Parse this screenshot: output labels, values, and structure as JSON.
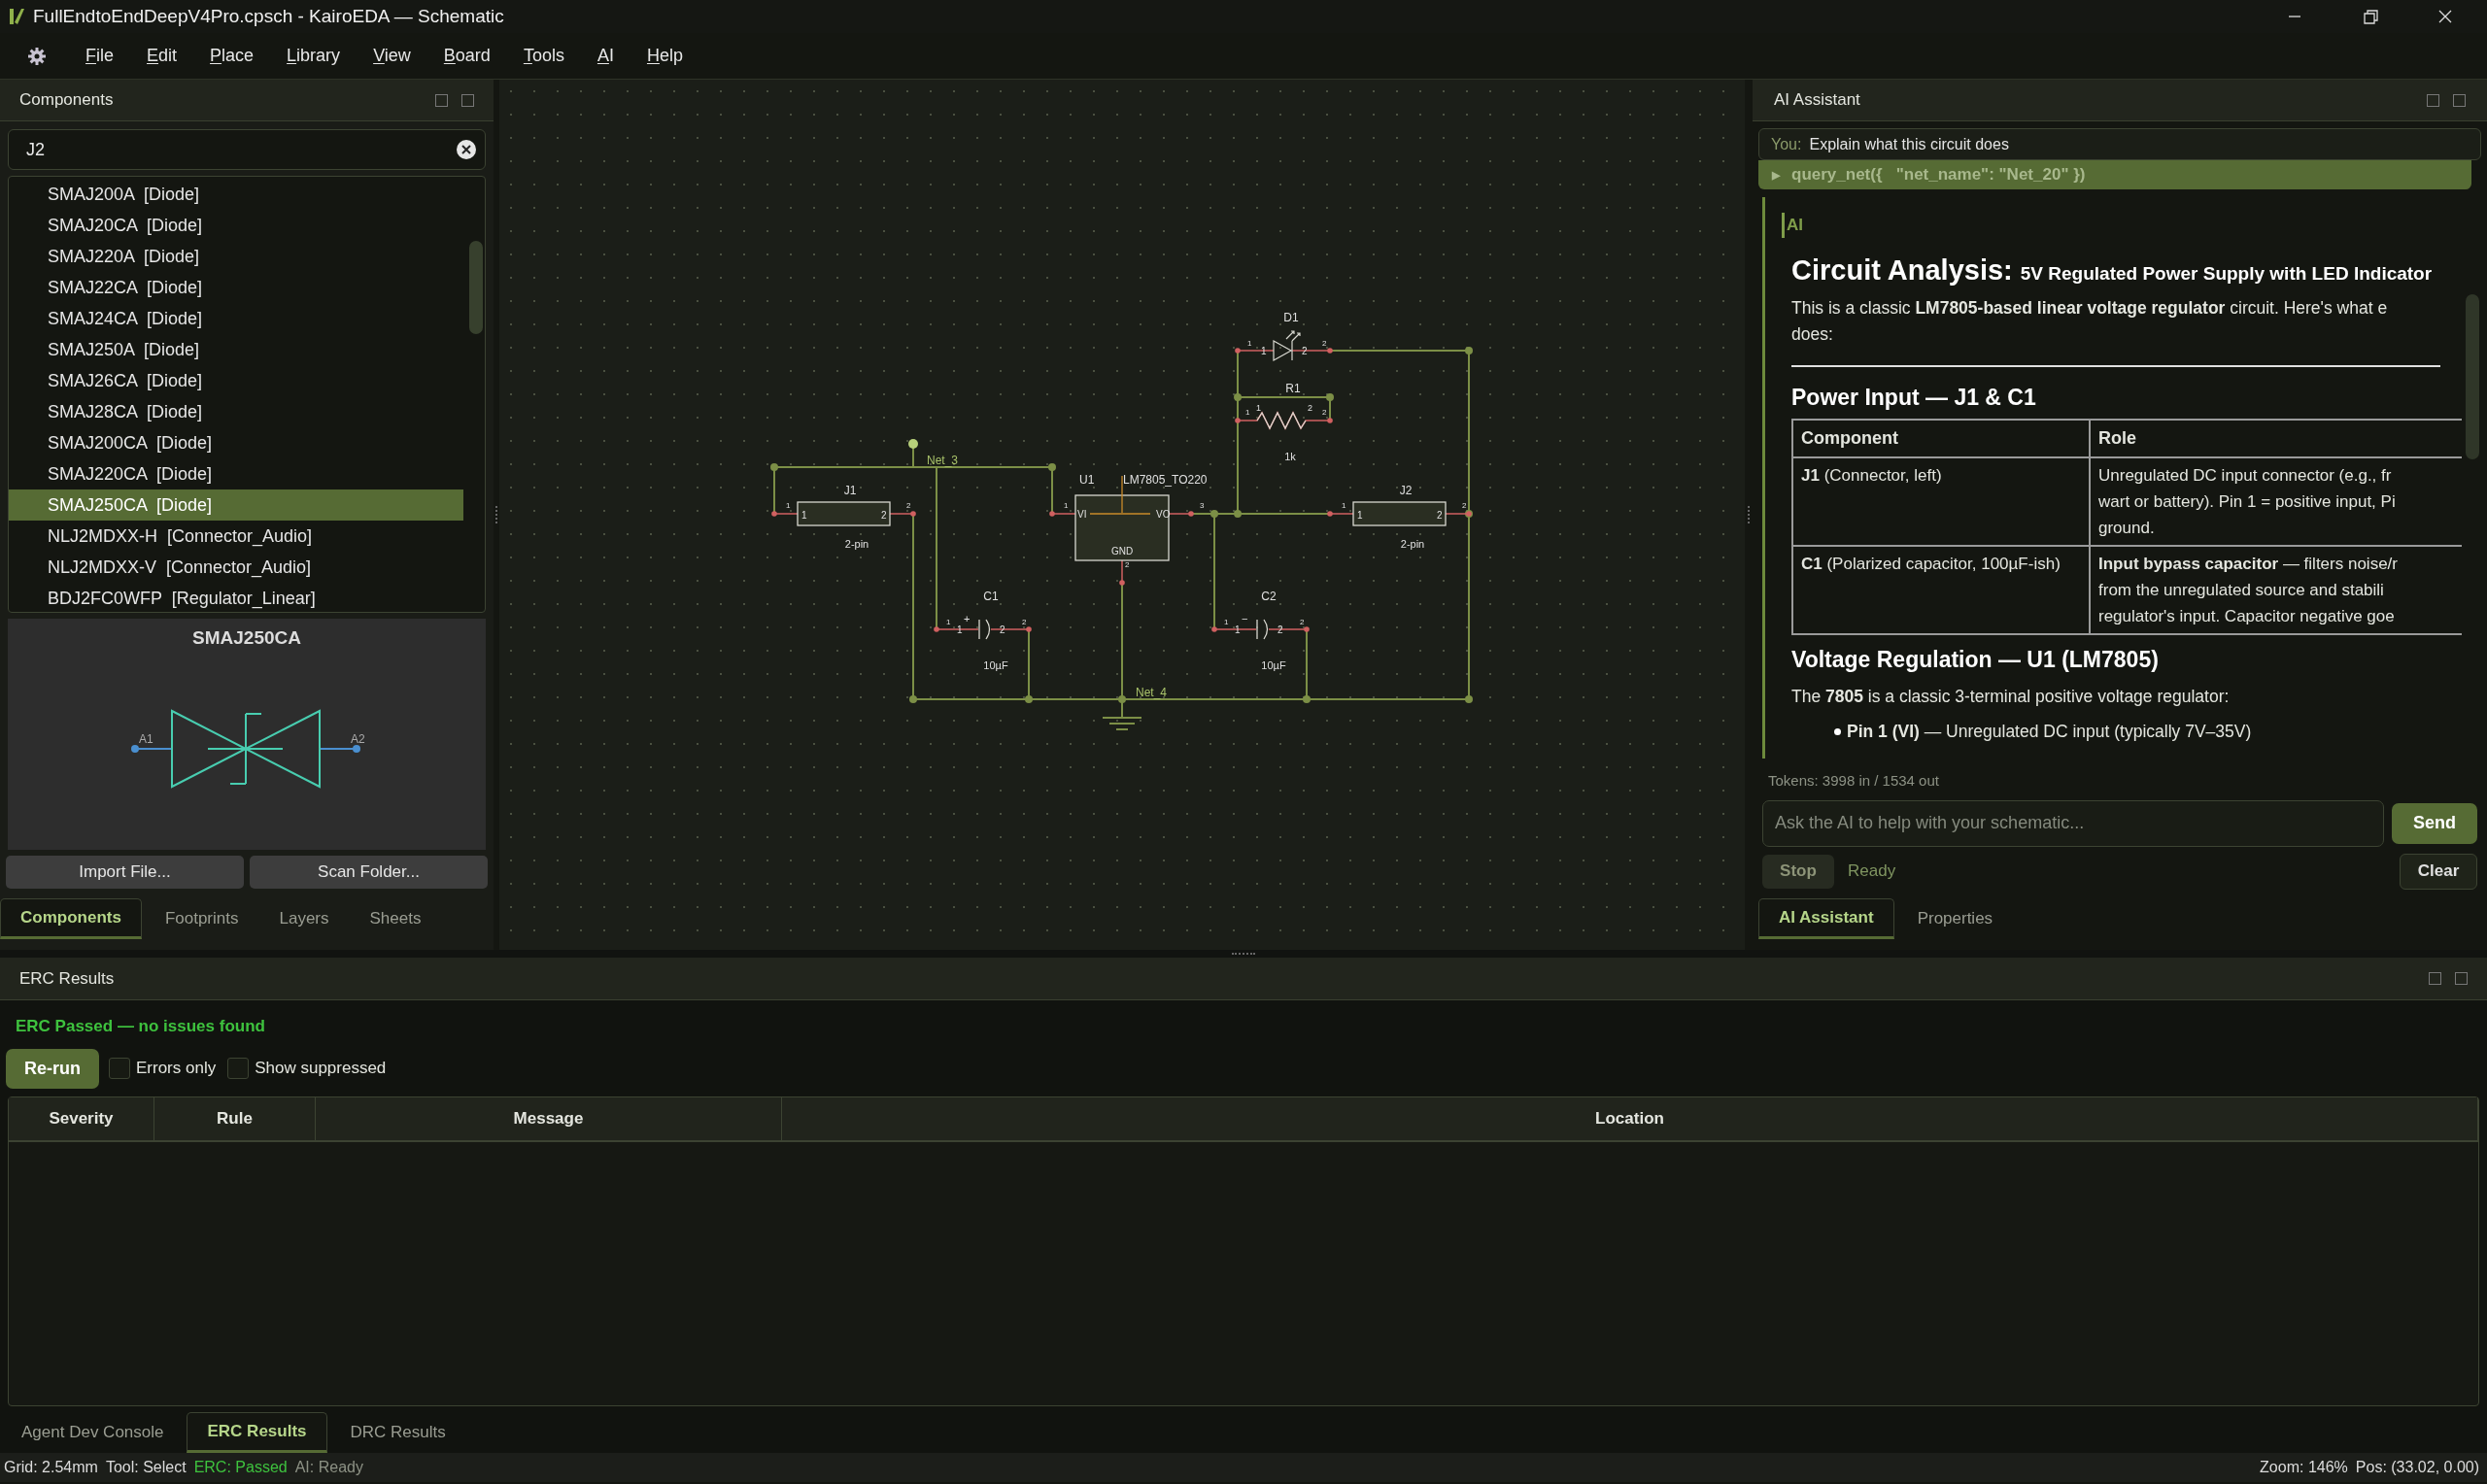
{
  "window": {
    "title": "FullEndtoEndDeepV4Pro.cpsch - KairoEDA — Schematic"
  },
  "menu": [
    {
      "label": "File"
    },
    {
      "label": "Edit"
    },
    {
      "label": "Place"
    },
    {
      "label": "Library"
    },
    {
      "label": "View"
    },
    {
      "label": "Board"
    },
    {
      "label": "Tools"
    },
    {
      "label": "AI"
    },
    {
      "label": "Help"
    }
  ],
  "components_panel": {
    "title": "Components",
    "search": {
      "value": "J2"
    },
    "items": [
      {
        "name": "SMAJ200A",
        "category": "[Diode]",
        "selected": false
      },
      {
        "name": "SMAJ20CA",
        "category": "[Diode]",
        "selected": false
      },
      {
        "name": "SMAJ220A",
        "category": "[Diode]",
        "selected": false
      },
      {
        "name": "SMAJ22CA",
        "category": "[Diode]",
        "selected": false
      },
      {
        "name": "SMAJ24CA",
        "category": "[Diode]",
        "selected": false
      },
      {
        "name": "SMAJ250A",
        "category": "[Diode]",
        "selected": false
      },
      {
        "name": "SMAJ26CA",
        "category": "[Diode]",
        "selected": false
      },
      {
        "name": "SMAJ28CA",
        "category": "[Diode]",
        "selected": false
      },
      {
        "name": "SMAJ200CA",
        "category": "[Diode]",
        "selected": false
      },
      {
        "name": "SMAJ220CA",
        "category": "[Diode]",
        "selected": false
      },
      {
        "name": "SMAJ250CA",
        "category": "[Diode]",
        "selected": true
      },
      {
        "name": "NLJ2MDXX-H",
        "category": "[Connector_Audio]",
        "selected": false
      },
      {
        "name": "NLJ2MDXX-V",
        "category": "[Connector_Audio]",
        "selected": false
      },
      {
        "name": "BDJ2FC0WFP",
        "category": "[Regulator_Linear]",
        "selected": false
      }
    ],
    "preview": {
      "title": "SMAJ250CA",
      "pins": [
        "A1",
        "A2"
      ]
    },
    "buttons": [
      "Import File...",
      "Scan Folder..."
    ],
    "tabs": [
      {
        "label": "Components",
        "selected": true
      },
      {
        "label": "Footprints",
        "selected": false
      },
      {
        "label": "Layers",
        "selected": false
      },
      {
        "label": "Sheets",
        "selected": false
      }
    ]
  },
  "schematic": {
    "components": [
      {
        "kind": "connector",
        "ref": "J1",
        "value": "2-pin",
        "pin_numbers": [
          "1",
          "2"
        ],
        "pin_names": [
          "1",
          "2"
        ]
      },
      {
        "kind": "regulator",
        "ref": "U1",
        "value": "LM7805_TO220",
        "pin_numbers": [
          "1",
          "3",
          "2"
        ],
        "pin_names": [
          "VI",
          "VO",
          "GND"
        ]
      },
      {
        "kind": "led",
        "ref": "D1",
        "pin_numbers": [
          "1",
          "2"
        ],
        "pin_names": [
          "1",
          "2"
        ]
      },
      {
        "kind": "resistor",
        "ref": "R1",
        "value": "1k",
        "pin_numbers": [
          "1",
          "2"
        ],
        "pin_names": [
          "1",
          "2"
        ]
      },
      {
        "kind": "connector",
        "ref": "J2",
        "value": "2-pin",
        "pin_numbers": [
          "1",
          "2"
        ],
        "pin_names": [
          "1",
          "2"
        ]
      },
      {
        "kind": "capacitor",
        "ref": "C1",
        "value": "10µF",
        "polarity": "+",
        "pin_numbers": [
          "1",
          "2"
        ],
        "pin_names": [
          "1",
          "2"
        ]
      },
      {
        "kind": "capacitor",
        "ref": "C2",
        "value": "10µF",
        "polarity": "−",
        "pin_numbers": [
          "1",
          "2"
        ],
        "pin_names": [
          "1",
          "2"
        ]
      }
    ],
    "nets": [
      "Net_3",
      "Net_4"
    ]
  },
  "ai_panel": {
    "title": "AI Assistant",
    "user_message": {
      "prefix": "You:",
      "text": "Explain what this circuit does"
    },
    "tool_call": {
      "icon": "▶",
      "text": "query_net({   \"net_name\": \"Net_20\" })"
    },
    "response": {
      "label": "AI",
      "heading": "Circuit Analysis:",
      "subheading": "5V Regulated Power Supply with LED Indicator",
      "intro": [
        "This is a classic **LM7805-based linear voltage regulator** circuit. Here's what e",
        "does:"
      ],
      "section1": "Power Input — J1 & C1",
      "table": {
        "columns": [
          "Component",
          "Role"
        ],
        "rows": [
          {
            "component": "**J1** (Connector, left)",
            "role": [
              "Unregulated DC input connector (e.g., fr",
              "wart or battery). Pin 1 = positive input, Pi",
              "ground."
            ]
          },
          {
            "component": "**C1** (Polarized capacitor, 100µF-ish)",
            "role": [
              "**Input bypass capacitor** — filters noise/r",
              "from the unregulated source and stabili",
              "regulator's input. Capacitor negative goe"
            ]
          }
        ]
      },
      "section2": "Voltage Regulation — U1 (LM7805)",
      "para2": "The **7805** is a classic 3-terminal positive voltage regulator:",
      "bullets": [
        "**Pin 1 (VI)** — Unregulated DC input (typically 7V–35V)"
      ]
    },
    "tokens": "Tokens: 3998 in / 1534 out",
    "input": {
      "placeholder": "Ask the AI to help with your schematic..."
    },
    "send": "Send",
    "stop": "Stop",
    "status": "Ready",
    "clear": "Clear",
    "tabs": [
      {
        "label": "AI Assistant",
        "selected": true
      },
      {
        "label": "Properties",
        "selected": false
      }
    ]
  },
  "erc_panel": {
    "title": "ERC Results",
    "result": "ERC Passed — no issues found",
    "rerun": "Re-run",
    "filters": [
      {
        "label": "Errors only",
        "checked": false
      },
      {
        "label": "Show suppressed",
        "checked": false
      }
    ],
    "columns": [
      "Severity",
      "Rule",
      "Message",
      "Location"
    ]
  },
  "bottom_tabs": [
    {
      "label": "Agent Dev Console",
      "selected": false
    },
    {
      "label": "ERC Results",
      "selected": true
    },
    {
      "label": "DRC Results",
      "selected": false
    }
  ],
  "status_bar": {
    "grid": "Grid: 2.54mm",
    "tool": "Tool: Select",
    "erc": "ERC: Passed",
    "ai": "AI: Ready",
    "zoom": "Zoom: 146%",
    "pos": "Pos: (33.02, 0.00)"
  }
}
